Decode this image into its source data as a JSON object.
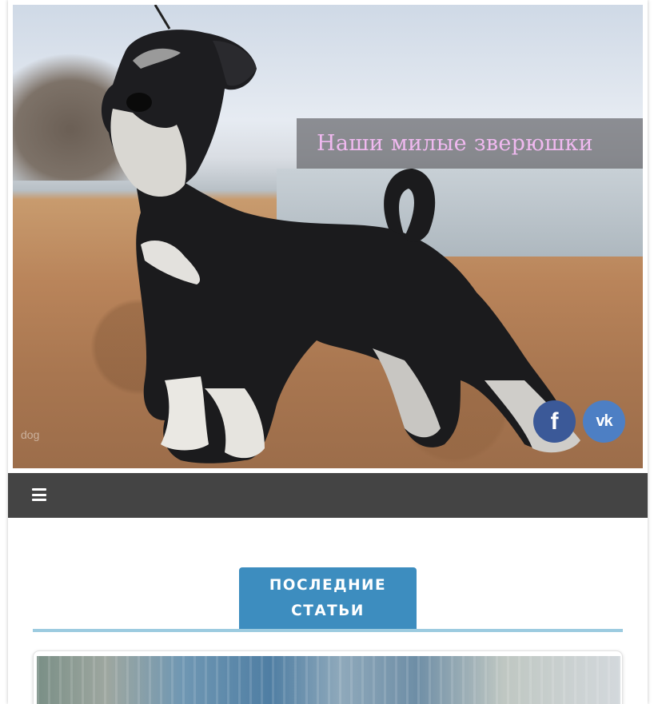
{
  "header": {
    "site_title": "Наши милые зверюшки",
    "hero_watermark": "dog"
  },
  "social": {
    "facebook_glyph": "f",
    "vk_glyph": "vk"
  },
  "nav": {
    "menu_icon": "bars-icon"
  },
  "section": {
    "title": "ПОСЛЕДНИЕ СТАТЬИ"
  },
  "colors": {
    "navbar": "#444444",
    "accent": "#3d8dbf",
    "title_pink": "#f0b9f0",
    "facebook": "#3b5998",
    "vk": "#4d7fc4"
  }
}
